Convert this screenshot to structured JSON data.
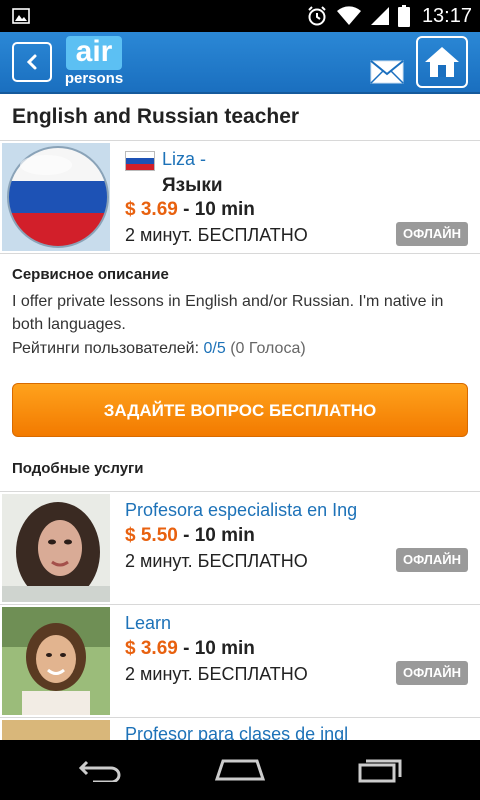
{
  "status_bar": {
    "time": "13:17"
  },
  "header": {
    "logo_top": "air",
    "logo_bottom": "persons"
  },
  "page_title": "English and Russian teacher",
  "main_service": {
    "name": "Liza -",
    "category": "Языки",
    "price": "$ 3.69",
    "duration": "- 10 min",
    "free_text": "2 минут. БЕСПЛАТНО",
    "status": "ОФЛАЙН"
  },
  "description": {
    "heading": "Сервисное описание",
    "text": "I offer private lessons in English and/or Russian. I'm native in both languages.",
    "rating_label": "Рейтинги пользователей:",
    "rating_value": "0/5",
    "rating_count": "(0 Голоса)"
  },
  "cta_label": "ЗАДАЙТЕ ВОПРОС БЕСПЛАТНО",
  "similar": {
    "heading": "Подобные услуги",
    "items": [
      {
        "name": "Profesora especialista en Ing",
        "price": "$ 5.50",
        "duration": "- 10 min",
        "free_text": "2 минут. БЕСПЛАТНО",
        "status": "ОФЛАЙН"
      },
      {
        "name": "Learn",
        "price": "$ 3.69",
        "duration": "- 10 min",
        "free_text": "2 минут. БЕСПЛАТНО",
        "status": "ОФЛАЙН"
      },
      {
        "name": "Profesor para clases de ingl"
      }
    ]
  },
  "colors": {
    "header_blue": "#1a6fbf",
    "link_blue": "#1d72b8",
    "price_orange": "#e8610f",
    "cta_orange": "#f27a00"
  },
  "icons": [
    "picture-icon",
    "alarm-icon",
    "wifi-icon",
    "signal-icon",
    "battery-icon",
    "back-arrow-icon",
    "mail-icon",
    "home-icon",
    "russian-flag-icon",
    "nav-back-icon",
    "nav-home-icon",
    "nav-recents-icon"
  ]
}
